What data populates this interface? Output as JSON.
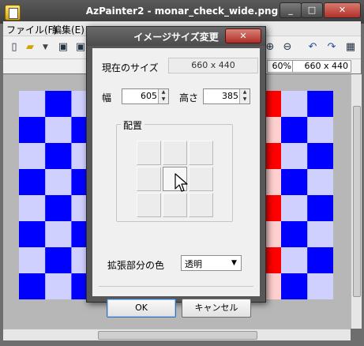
{
  "window": {
    "title": "AzPainter2 - monar_check_wide.png",
    "min_glyph": "_",
    "max_glyph": "□",
    "close_glyph": "✕"
  },
  "menu": {
    "file": "ファイル(F)",
    "edit": "編集(E)"
  },
  "toolbar": {
    "new": "new-file-icon",
    "open": "open-folder-icon",
    "save": "save-icon",
    "saveas": "save-as-icon",
    "zoom_in": "zoom-in-icon",
    "zoom_out": "zoom-out-icon",
    "undo": "undo-icon",
    "redo": "redo-icon"
  },
  "status": {
    "zoom": "60%",
    "size": "660 x 440"
  },
  "canvas": {
    "checker_colors": {
      "blue": "#0000ff",
      "lavender": "#d0d0ff",
      "red": "#ff0000",
      "pink": "#ffd0d0"
    }
  },
  "dialog": {
    "title": "イメージサイズ変更",
    "close_glyph": "✕",
    "current_size_label": "現在のサイズ",
    "current_size_value": "660 x 440",
    "width_label": "幅",
    "width_value": "605",
    "height_label": "高さ",
    "height_value": "385",
    "placement_label": "配置",
    "placement_selected": "center",
    "ext_color_label": "拡張部分の色",
    "ext_color_value": "透明",
    "ok_label": "OK",
    "cancel_label": "キャンセル"
  }
}
